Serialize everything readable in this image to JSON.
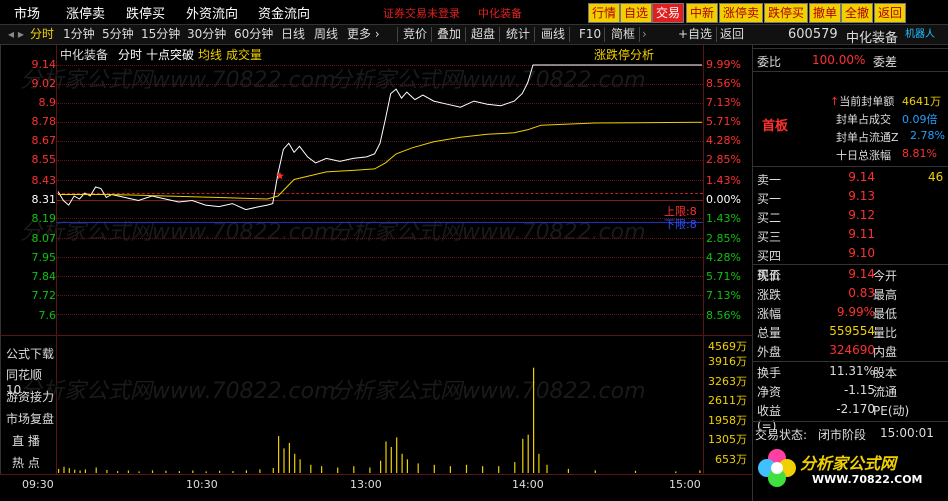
{
  "menu": {
    "items": [
      "市场",
      "涨停卖",
      "跌停买",
      "外资流向",
      "资金流向"
    ],
    "notice": "证券交易未登录",
    "notice_stock": "中化装备",
    "quick_buttons": [
      "行情",
      "自选",
      "交易",
      "中新",
      "涨停卖",
      "跌停买",
      "撤单",
      "全撤",
      "返回"
    ]
  },
  "toolbar": {
    "left_tabs": [
      "分时",
      "1分钟",
      "5分钟",
      "15分钟",
      "30分钟",
      "60分钟",
      "日线",
      "周线",
      "更多 ›"
    ],
    "right_tabs": [
      "竞价",
      "叠加",
      "超盘",
      "统计",
      "画线",
      "F10",
      "简框",
      "自选",
      "返回"
    ],
    "plus_self": "+自选"
  },
  "chart": {
    "stock_name": "中化装备",
    "period": "分时",
    "title_extra": "十点突破",
    "avg_label": "均线",
    "vol_label": "成交量",
    "analysis_label": "涨跌停分析",
    "upper_limit_label": "上限:8",
    "lower_limit_label": "下限:8",
    "watermark": "分析家公式网www.70822.com"
  },
  "chart_data": {
    "type": "line",
    "prev_close": 8.31,
    "ylim": [
      7.48,
      9.14
    ],
    "price_ticks": [
      9.14,
      9.02,
      8.9,
      8.78,
      8.67,
      8.55,
      8.43,
      8.31,
      8.19,
      8.07,
      7.95,
      7.84,
      7.72,
      7.6
    ],
    "pct_ticks": [
      "9.99%",
      "8.56%",
      "7.13%",
      "5.71%",
      "4.28%",
      "2.85%",
      "1.43%",
      "0.00%",
      "1.43%",
      "2.85%",
      "4.28%",
      "5.71%",
      "7.13%",
      "8.56%"
    ],
    "x_labels": [
      "09:30",
      "10:30",
      "13:00",
      "14:00",
      "15:00"
    ],
    "series": [
      {
        "name": "价格",
        "points": [
          [
            0,
            8.3
          ],
          [
            2,
            8.24
          ],
          [
            4,
            8.21
          ],
          [
            6,
            8.27
          ],
          [
            8,
            8.25
          ],
          [
            10,
            8.29
          ],
          [
            12,
            8.27
          ],
          [
            14,
            8.33
          ],
          [
            16,
            8.32
          ],
          [
            18,
            8.26
          ],
          [
            20,
            8.28
          ],
          [
            25,
            8.26
          ],
          [
            30,
            8.24
          ],
          [
            35,
            8.27
          ],
          [
            40,
            8.25
          ],
          [
            45,
            8.23
          ],
          [
            50,
            8.24
          ],
          [
            55,
            8.21
          ],
          [
            60,
            8.2
          ],
          [
            65,
            8.22
          ],
          [
            70,
            8.18
          ],
          [
            75,
            8.2
          ],
          [
            78,
            8.21
          ],
          [
            80,
            8.22
          ],
          [
            82,
            8.42
          ],
          [
            84,
            8.58
          ],
          [
            86,
            8.62
          ],
          [
            88,
            8.56
          ],
          [
            90,
            8.6
          ],
          [
            93,
            8.53
          ],
          [
            96,
            8.49
          ],
          [
            100,
            8.52
          ],
          [
            105,
            8.5
          ],
          [
            110,
            8.52
          ],
          [
            115,
            8.53
          ],
          [
            118,
            8.55
          ],
          [
            120,
            8.62
          ],
          [
            122,
            8.78
          ],
          [
            124,
            8.95
          ],
          [
            126,
            8.98
          ],
          [
            128,
            8.92
          ],
          [
            130,
            8.96
          ],
          [
            133,
            8.91
          ],
          [
            136,
            8.94
          ],
          [
            140,
            8.9
          ],
          [
            145,
            8.88
          ],
          [
            150,
            8.86
          ],
          [
            155,
            8.9
          ],
          [
            160,
            8.88
          ],
          [
            165,
            8.87
          ],
          [
            170,
            8.9
          ],
          [
            173,
            8.95
          ],
          [
            175,
            9.02
          ],
          [
            177,
            9.14
          ],
          [
            180,
            9.14
          ],
          [
            200,
            9.14
          ],
          [
            240,
            9.14
          ]
        ]
      },
      {
        "name": "均价",
        "points": [
          [
            0,
            8.28
          ],
          [
            20,
            8.28
          ],
          [
            40,
            8.27
          ],
          [
            60,
            8.26
          ],
          [
            78,
            8.25
          ],
          [
            82,
            8.27
          ],
          [
            88,
            8.38
          ],
          [
            100,
            8.43
          ],
          [
            110,
            8.44
          ],
          [
            118,
            8.45
          ],
          [
            122,
            8.49
          ],
          [
            126,
            8.55
          ],
          [
            132,
            8.59
          ],
          [
            140,
            8.63
          ],
          [
            150,
            8.66
          ],
          [
            160,
            8.68
          ],
          [
            170,
            8.69
          ],
          [
            175,
            8.71
          ],
          [
            180,
            8.74
          ],
          [
            200,
            8.755
          ],
          [
            240,
            8.76
          ]
        ]
      }
    ],
    "volume_ticks": [
      "4569万",
      "3916万",
      "3263万",
      "2611万",
      "1958万",
      "1305万",
      "653万"
    ],
    "volume_max": 4569,
    "volume_bars": [
      [
        0,
        150
      ],
      [
        2,
        230
      ],
      [
        4,
        180
      ],
      [
        6,
        120
      ],
      [
        8,
        90
      ],
      [
        10,
        130
      ],
      [
        14,
        200
      ],
      [
        18,
        110
      ],
      [
        22,
        70
      ],
      [
        26,
        90
      ],
      [
        30,
        60
      ],
      [
        35,
        100
      ],
      [
        40,
        80
      ],
      [
        45,
        70
      ],
      [
        50,
        90
      ],
      [
        55,
        60
      ],
      [
        60,
        80
      ],
      [
        65,
        70
      ],
      [
        70,
        100
      ],
      [
        75,
        130
      ],
      [
        80,
        180
      ],
      [
        82,
        1350
      ],
      [
        84,
        900
      ],
      [
        86,
        1100
      ],
      [
        88,
        700
      ],
      [
        90,
        500
      ],
      [
        94,
        300
      ],
      [
        98,
        250
      ],
      [
        104,
        200
      ],
      [
        110,
        250
      ],
      [
        116,
        200
      ],
      [
        120,
        450
      ],
      [
        122,
        1150
      ],
      [
        124,
        950
      ],
      [
        126,
        1300
      ],
      [
        128,
        700
      ],
      [
        130,
        500
      ],
      [
        134,
        350
      ],
      [
        140,
        300
      ],
      [
        146,
        250
      ],
      [
        152,
        300
      ],
      [
        158,
        250
      ],
      [
        164,
        250
      ],
      [
        170,
        400
      ],
      [
        173,
        1250
      ],
      [
        175,
        1400
      ],
      [
        177,
        3850
      ],
      [
        179,
        700
      ],
      [
        182,
        300
      ],
      [
        190,
        150
      ],
      [
        200,
        100
      ],
      [
        215,
        80
      ],
      [
        230,
        60
      ],
      [
        239,
        90
      ]
    ]
  },
  "left_panel": [
    "公式下载",
    "同花顺10",
    "游资接力",
    "市场复盘",
    "直 播",
    "热 点"
  ],
  "quote": {
    "code": "600579",
    "name": "中化装备",
    "robot_label": "机器人",
    "wei_bi_label": "委比",
    "wei_bi_value": "100.00%",
    "wei_cha_label": "委差",
    "first_board": "首板",
    "seal_amount_label": "当前封单额",
    "seal_amount_value": "4641万",
    "seal_deal_label": "封单占成交",
    "seal_deal_value": "0.09倍",
    "seal_float_label": "封单占流通Z",
    "seal_float_value": "2.78%",
    "ten_day_label": "十日总涨幅",
    "ten_day_value": "8.81%",
    "order_book": [
      {
        "label": "卖一",
        "price": "",
        "vol": ""
      },
      {
        "label": "买一",
        "price": "9.14",
        "vol": "46"
      },
      {
        "label": "买二",
        "price": "9.13",
        "vol": ""
      },
      {
        "label": "买三",
        "price": "9.12",
        "vol": ""
      },
      {
        "label": "买四",
        "price": "9.11",
        "vol": ""
      },
      {
        "label": "买五",
        "price": "9.10",
        "vol": ""
      }
    ],
    "stats": [
      {
        "l1": "现价",
        "v1": "9.14",
        "l2": "今开",
        "v2": ""
      },
      {
        "l1": "涨跌",
        "v1": "0.83",
        "l2": "最高",
        "v2": ""
      },
      {
        "l1": "涨幅",
        "v1": "9.99%",
        "l2": "最低",
        "v2": ""
      },
      {
        "l1": "总量",
        "v1": "559554",
        "l2": "量比",
        "v2": ""
      },
      {
        "l1": "外盘",
        "v1": "324690",
        "l2": "内盘",
        "v2": ""
      }
    ],
    "stats2": [
      {
        "l1": "换手",
        "v1": "11.31%",
        "l2": "股本"
      },
      {
        "l1": "净资",
        "v1": "-1.15",
        "l2": "流通"
      },
      {
        "l1": "收益(=)",
        "v1": "-2.170",
        "l2": "PE(动)"
      }
    ],
    "trade_status_label": "交易状态:",
    "trade_status_value": "闭市阶段",
    "trade_time": "15:00:01",
    "logo_text": "分析家公式网",
    "logo_url": "WWW.70822.COM"
  }
}
